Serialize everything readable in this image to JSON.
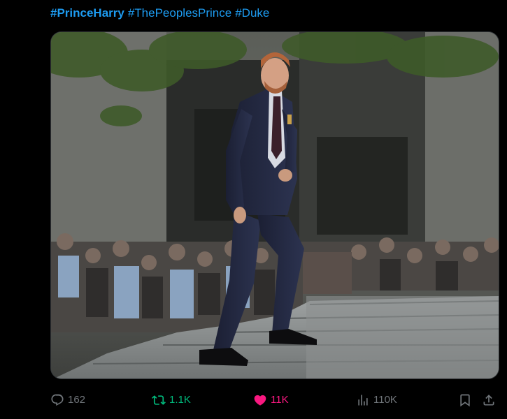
{
  "tweet": {
    "hashtags": [
      "#PrinceHarry",
      "#ThePeoplesPrince",
      "#Duke"
    ],
    "image_alt": "Prince Harry in a dark suit climbing stone steps in front of a crowd of photographers"
  },
  "actions": {
    "replies": "162",
    "reposts": "1.1K",
    "likes": "11K",
    "views": "110K"
  },
  "colors": {
    "link": "#1d9bf0",
    "repost_active": "#00ba7c",
    "like_active": "#f91880",
    "muted": "#71767b"
  },
  "icons": [
    "reply-icon",
    "repost-icon",
    "heart-icon",
    "views-icon",
    "bookmark-icon",
    "share-icon"
  ]
}
